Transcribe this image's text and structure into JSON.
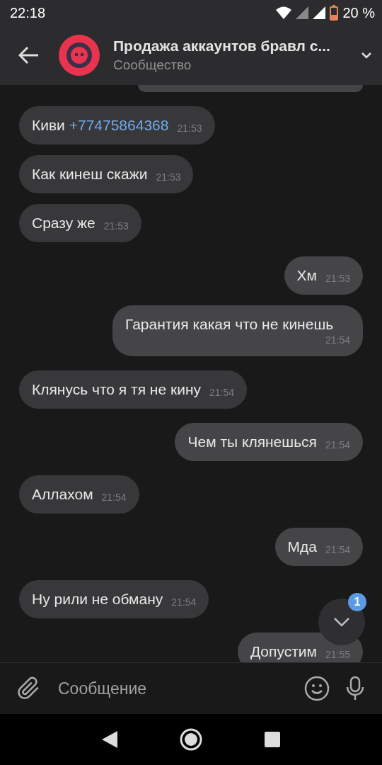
{
  "status_bar": {
    "time": "22:18",
    "battery": "20 %"
  },
  "header": {
    "title": "Продажа аккаунтов бравл с...",
    "subtitle": "Сообщество"
  },
  "messages": [
    {
      "text": "Киви",
      "phone": "+77475864368",
      "time": "21:53",
      "outgoing": false
    },
    {
      "text": "Как кинеш скажи",
      "time": "21:53",
      "outgoing": false
    },
    {
      "text": "Сразу же",
      "time": "21:53",
      "outgoing": false
    },
    {
      "text": "Хм",
      "time": "21:53",
      "outgoing": true
    },
    {
      "text": "Гарантия какая что не кинешь",
      "time": "21:54",
      "outgoing": true
    },
    {
      "text": "Клянусь что я тя не кину",
      "time": "21:54",
      "outgoing": false
    },
    {
      "text": "Чем ты клянешься",
      "time": "21:54",
      "outgoing": true
    },
    {
      "text": "Аллахом",
      "time": "21:54",
      "outgoing": false
    },
    {
      "text": "Мда",
      "time": "21:54",
      "outgoing": true
    },
    {
      "text": "Ну рили не обману",
      "time": "21:54",
      "outgoing": false
    },
    {
      "text": "Допустим",
      "time": "21:55",
      "outgoing": true
    }
  ],
  "scroll_button": {
    "badge": "1"
  },
  "composer": {
    "placeholder": "Сообщение"
  }
}
